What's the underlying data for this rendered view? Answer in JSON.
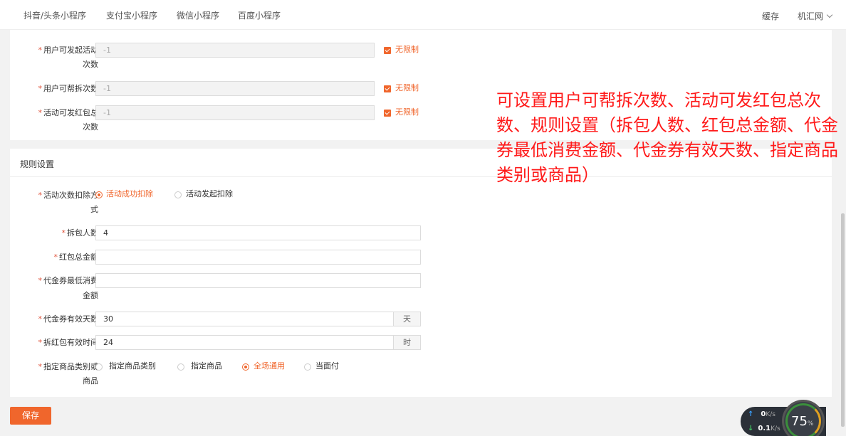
{
  "topnav": {
    "tabs": [
      "抖音/头条小程序",
      "支付宝小程序",
      "微信小程序",
      "百度小程序"
    ],
    "cache_label": "缓存",
    "user_menu": "机汇网"
  },
  "limits": {
    "launch_label_1": "用户可发起活动",
    "launch_label_2": "次数",
    "launch_value": "-1",
    "help_label": "用户可帮拆次数",
    "help_value": "-1",
    "redpack_label_1": "活动可发红包总",
    "redpack_label_2": "次数",
    "redpack_value": "-1",
    "unlimited": "无限制"
  },
  "rules": {
    "section_title": "规则设置",
    "deduct_label_1": "活动次数扣除方",
    "deduct_label_2": "式",
    "deduct_options": [
      "活动成功扣除",
      "活动发起扣除"
    ],
    "deduct_selected": 0,
    "people_label": "拆包人数",
    "people_value": "4",
    "total_label": "红包总金额",
    "total_value": "",
    "min_label_1": "代金券最低消费",
    "min_label_2": "金额",
    "min_value": "",
    "days_label": "代金券有效天数",
    "days_value": "30",
    "days_unit": "天",
    "time_label": "拆红包有效时间",
    "time_value": "24",
    "time_unit": "时",
    "scope_label_1": "指定商品类别或",
    "scope_label_2": "商品",
    "scope_options": [
      "指定商品类别",
      "指定商品",
      "全场通用",
      "当面付"
    ],
    "scope_selected": 2
  },
  "save_label": "保存",
  "annotation": "可设置用户可帮拆次数、活动可发红包总次数、规则设置（拆包人数、红包总金额、代金券最低消费金额、代金券有效天数、指定商品类别或商品）",
  "net_widget": {
    "up_value": "0",
    "up_unit": "K/s",
    "down_value": "0.1",
    "down_unit": "K/s",
    "gauge_value": "75",
    "gauge_unit": "%"
  },
  "colors": {
    "accent": "#f0662c",
    "annotation": "#ff1a1a",
    "required_star": "#e0543c"
  }
}
